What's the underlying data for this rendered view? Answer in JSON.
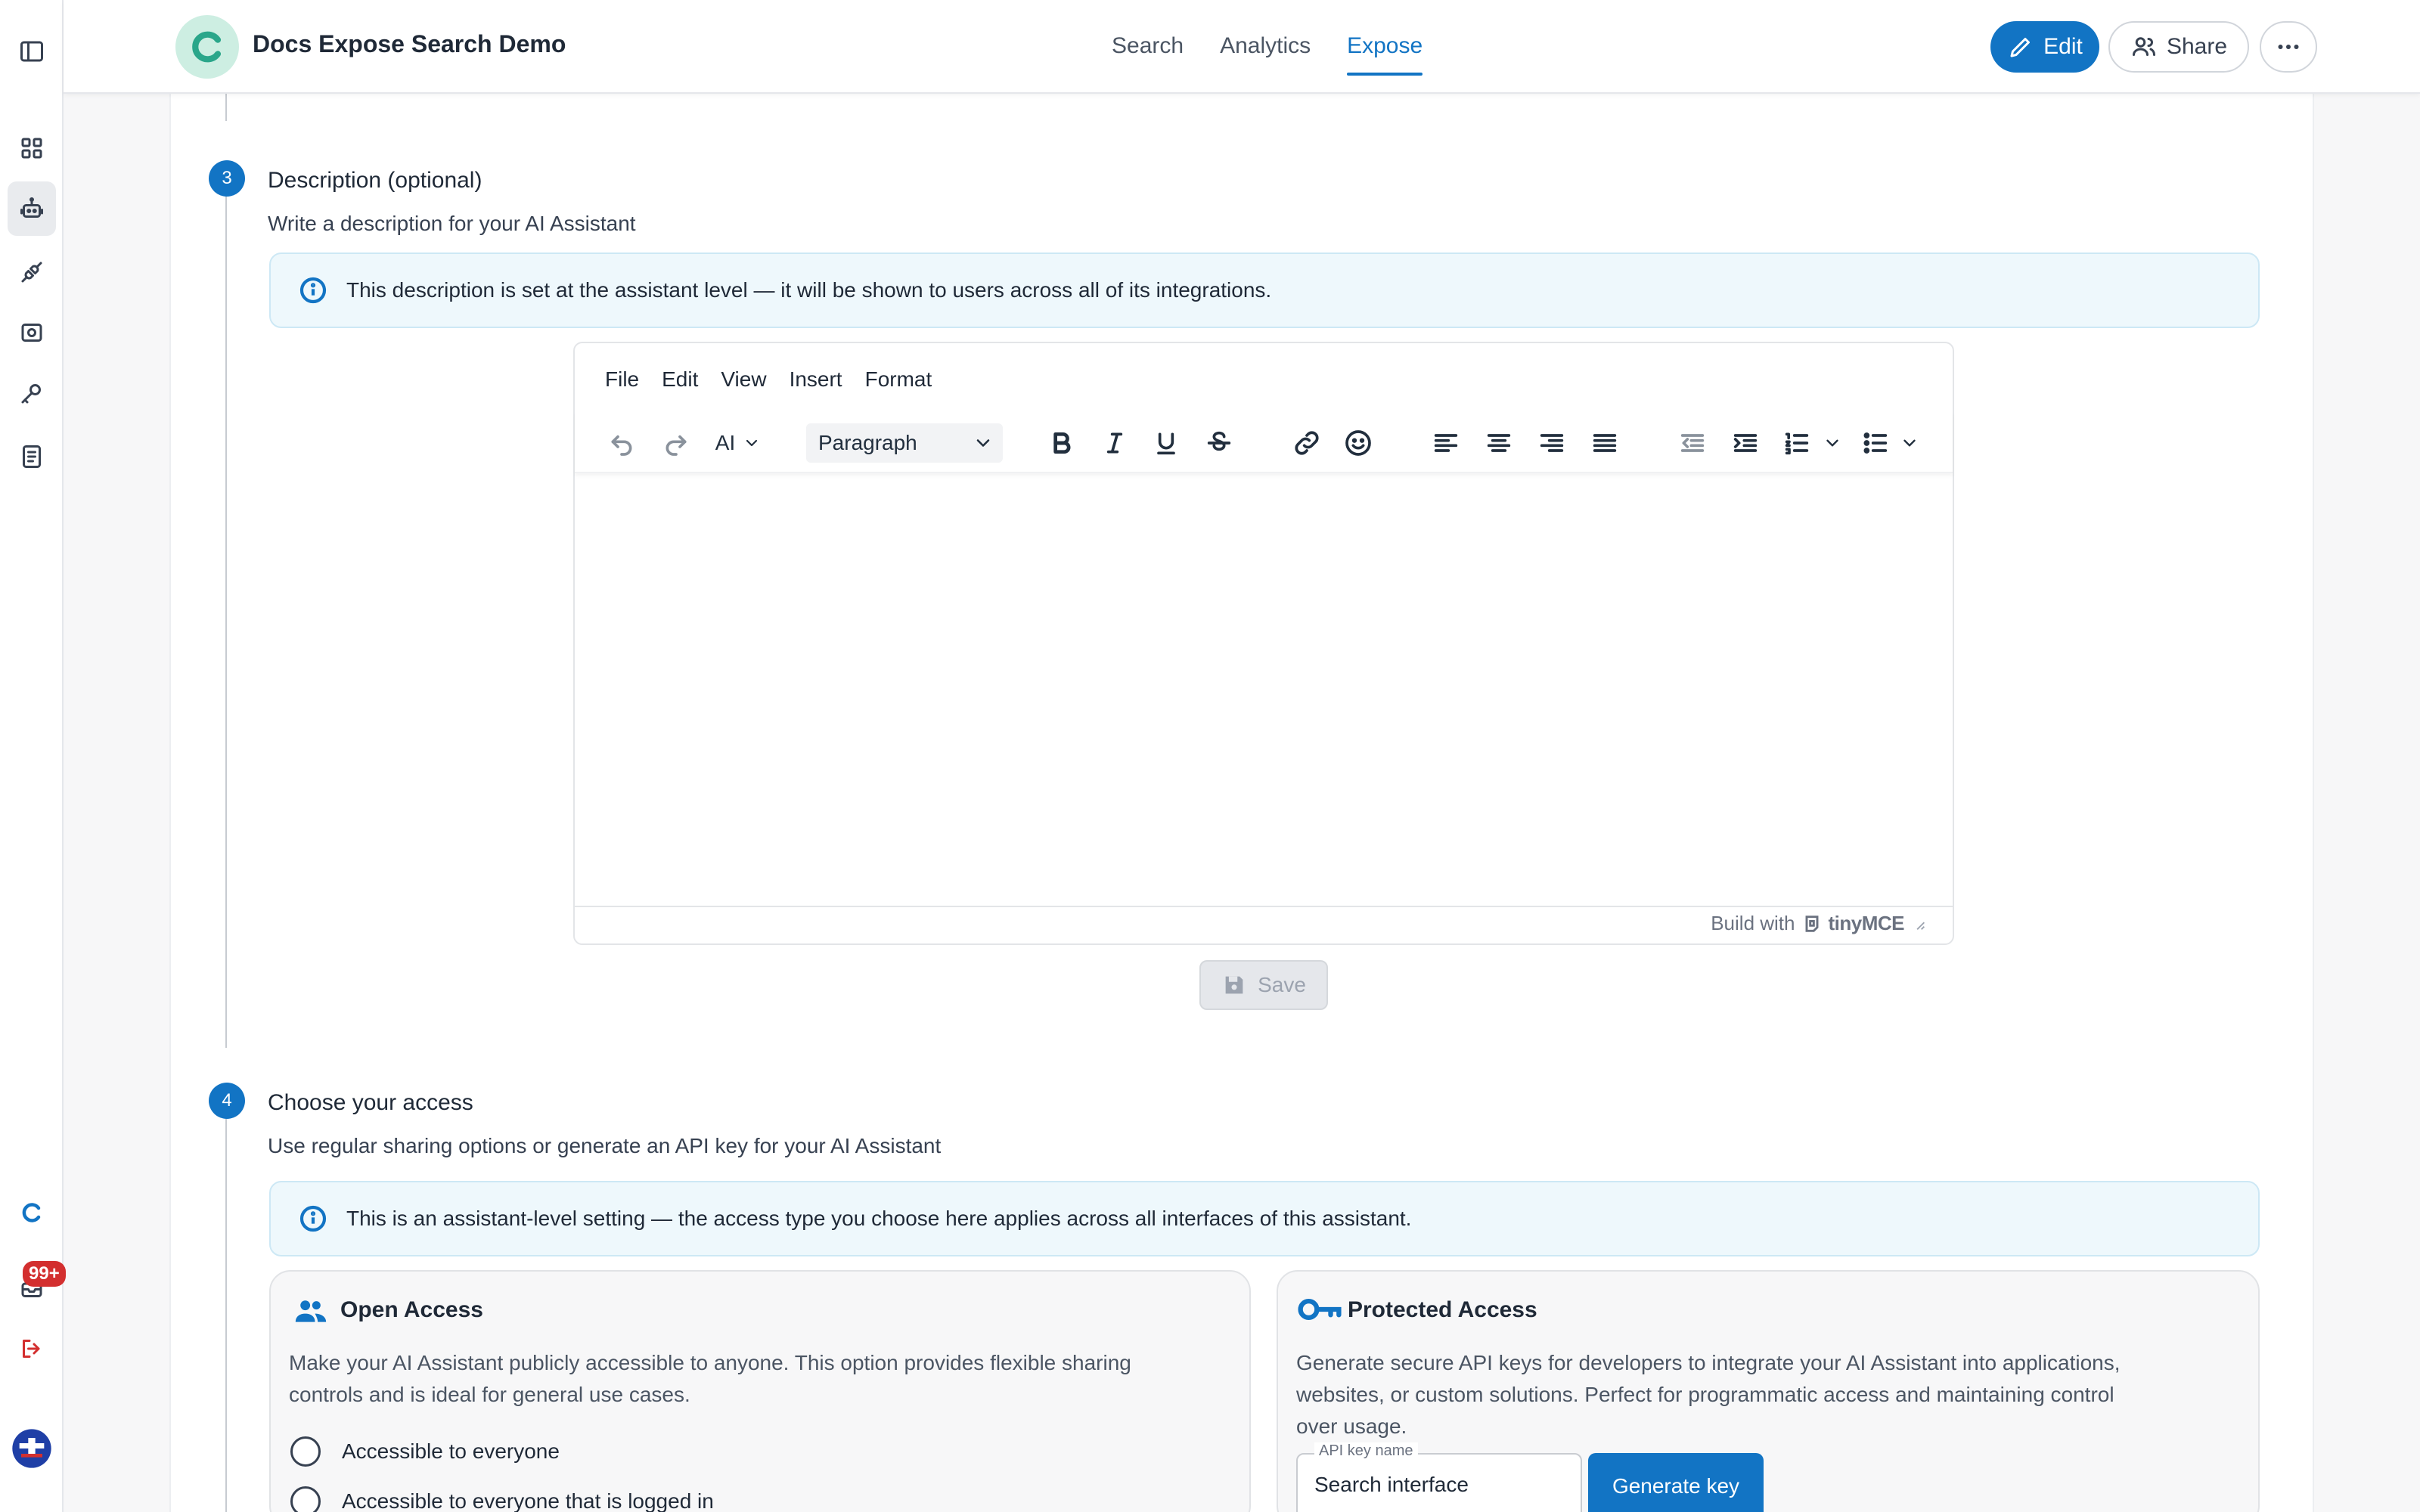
{
  "app": {
    "title": "Docs Expose Search Demo"
  },
  "nav": {
    "tabs": [
      {
        "label": "Search"
      },
      {
        "label": "Analytics"
      },
      {
        "label": "Expose"
      }
    ]
  },
  "actions": {
    "edit_label": "Edit",
    "share_label": "Share"
  },
  "notifications": {
    "badge": "99+"
  },
  "step3": {
    "number": "3",
    "title": "Description (optional)",
    "subtitle": "Write a description for your AI Assistant",
    "info": "This description is set at the assistant level — it will be shown to users across all of its integrations."
  },
  "editor": {
    "menu": [
      "File",
      "Edit",
      "View",
      "Insert",
      "Format"
    ],
    "ai_label": "AI",
    "block_format": "Paragraph",
    "footer_prefix": "Build with",
    "footer_brand": "tinyMCE",
    "save_label": "Save"
  },
  "step4": {
    "number": "4",
    "title": "Choose your access",
    "subtitle": "Use regular sharing options or generate an API key for your AI Assistant",
    "info": "This is an assistant-level setting — the access type you choose here applies across all interfaces of this assistant."
  },
  "open_access": {
    "title": "Open Access",
    "description_line1": "Make your AI Assistant publicly accessible to anyone. This option provides flexible sharing",
    "description_line2": "controls and is ideal for general use cases.",
    "options": [
      {
        "label": "Accessible to everyone"
      },
      {
        "label": "Accessible to everyone that is logged in"
      }
    ]
  },
  "protected_access": {
    "title": "Protected Access",
    "description_line1": "Generate secure API keys for developers to integrate your AI Assistant into applications,",
    "description_line2": "websites, or custom solutions. Perfect for programmatic access and maintaining control",
    "description_line3": "over usage.",
    "key_label": "API key name",
    "key_value": "Search interface",
    "generate_label": "Generate key"
  },
  "colors": {
    "accent": "#1274c4",
    "info_bg": "#eef8fc",
    "badge": "#d32f2f",
    "logo_teal": "#2aa68a"
  }
}
